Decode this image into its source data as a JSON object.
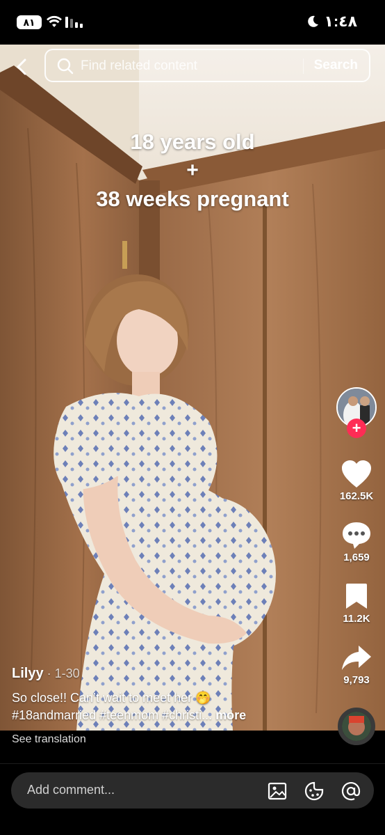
{
  "status_bar": {
    "battery": "٨١",
    "time": "١:٤٨"
  },
  "search": {
    "placeholder": "Find related content",
    "button_label": "Search"
  },
  "video": {
    "caption_line1": "18 years old",
    "caption_line2": "+",
    "caption_line3": "38 weeks pregnant"
  },
  "rail": {
    "likes": "162.5K",
    "comments": "1,659",
    "saves": "11.2K",
    "shares": "9,793"
  },
  "post": {
    "author": "Lilyy",
    "date": " · 1-30",
    "description_line1": "So close!! Can’t wait to meet her 🤭",
    "description_line2": "#18andmarried #teenmom #christi...",
    "more_label": " more",
    "see_translation": "See translation"
  },
  "comment_bar": {
    "placeholder": "Add comment..."
  },
  "colors": {
    "accent": "#fe2c55",
    "background": "#000000",
    "wood": "#9c6a45"
  }
}
